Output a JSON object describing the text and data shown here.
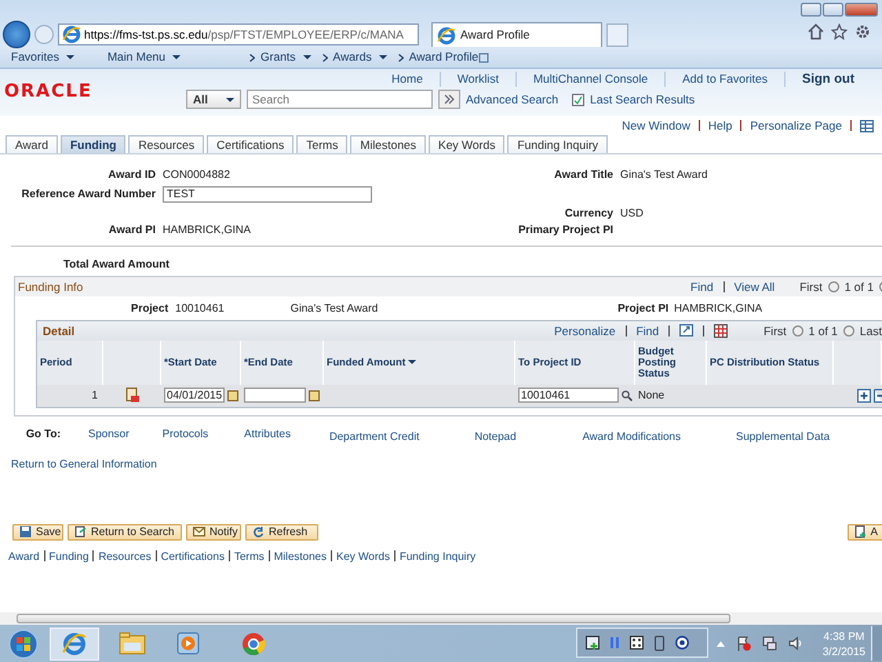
{
  "browser": {
    "url_host": "https://fms-tst.ps.sc.edu",
    "url_path": "/psp/FTST/EMPLOYEE/ERP/c/MANA",
    "tab_title": "Award Profile"
  },
  "breadcrumbs": [
    {
      "label": "Favorites",
      "dropdown": true
    },
    {
      "label": "Main Menu",
      "dropdown": true
    },
    {
      "label": "Grants",
      "dropdown": true
    },
    {
      "label": "Awards",
      "dropdown": true
    },
    {
      "label": "Award Profile",
      "dropdown": false
    }
  ],
  "header_links": [
    "Home",
    "Worklist",
    "MultiChannel Console",
    "Add to Favorites",
    "Sign out"
  ],
  "logo": "ORACLE",
  "search": {
    "scope": "All",
    "placeholder": "Search",
    "advanced": "Advanced Search",
    "last_results": "Last Search Results"
  },
  "page_links": [
    "New Window",
    "Help",
    "Personalize Page"
  ],
  "tabs": [
    {
      "label": "Award",
      "selected": false
    },
    {
      "label": "Funding",
      "selected": true
    },
    {
      "label": "Resources",
      "selected": false
    },
    {
      "label": "Certifications",
      "selected": false
    },
    {
      "label": "Terms",
      "selected": false
    },
    {
      "label": "Milestones",
      "selected": false
    },
    {
      "label": "Key Words",
      "selected": false
    },
    {
      "label": "Funding Inquiry",
      "selected": false
    }
  ],
  "award": {
    "award_id_label": "Award ID",
    "award_id": "CON0004882",
    "reference_label": "Reference Award Number",
    "reference": "TEST",
    "award_pi_label": "Award PI",
    "award_pi": "HAMBRICK,GINA",
    "title_label": "Award Title",
    "title": "Gina's Test Award",
    "currency_label": "Currency",
    "currency": "USD",
    "primary_pi_label": "Primary Project PI",
    "total_label": "Total Award Amount"
  },
  "funding_info": {
    "title": "Funding Info",
    "links": [
      "Find",
      "View All"
    ],
    "first": "First",
    "count": "1 of 1",
    "project_label": "Project",
    "project": "10010461",
    "project_desc": "Gina's Test Award",
    "project_pi_label": "Project PI",
    "project_pi": "HAMBRICK,GINA",
    "detail": {
      "title": "Detail",
      "links": [
        "Personalize",
        "Find"
      ],
      "first": "First",
      "count": "1 of 1",
      "last": "Last",
      "columns": [
        "Period",
        "*Start Date",
        "*End Date",
        "Funded Amount",
        "To Project ID",
        "Budget Posting Status",
        "PC Distribution Status"
      ],
      "rows": [
        {
          "period": "1",
          "start_date": "04/01/2015",
          "end_date": "",
          "to_project": "10010461",
          "budget_status": "None"
        }
      ]
    }
  },
  "goto": {
    "label": "Go To:",
    "links": [
      "Sponsor",
      "Protocols",
      "Attributes",
      "Department Credit",
      "Notepad",
      "Award Modifications",
      "Supplemental Data"
    ],
    "return_link": "Return to General Information"
  },
  "buttons": [
    "Save",
    "Return to Search",
    "Notify",
    "Refresh"
  ],
  "cut_button": "A",
  "footer_links": [
    "Award",
    "Funding",
    "Resources",
    "Certifications",
    "Terms",
    "Milestones",
    "Key Words",
    "Funding Inquiry"
  ],
  "taskbar": {
    "time": "4:38 PM",
    "date": "3/2/2015"
  }
}
